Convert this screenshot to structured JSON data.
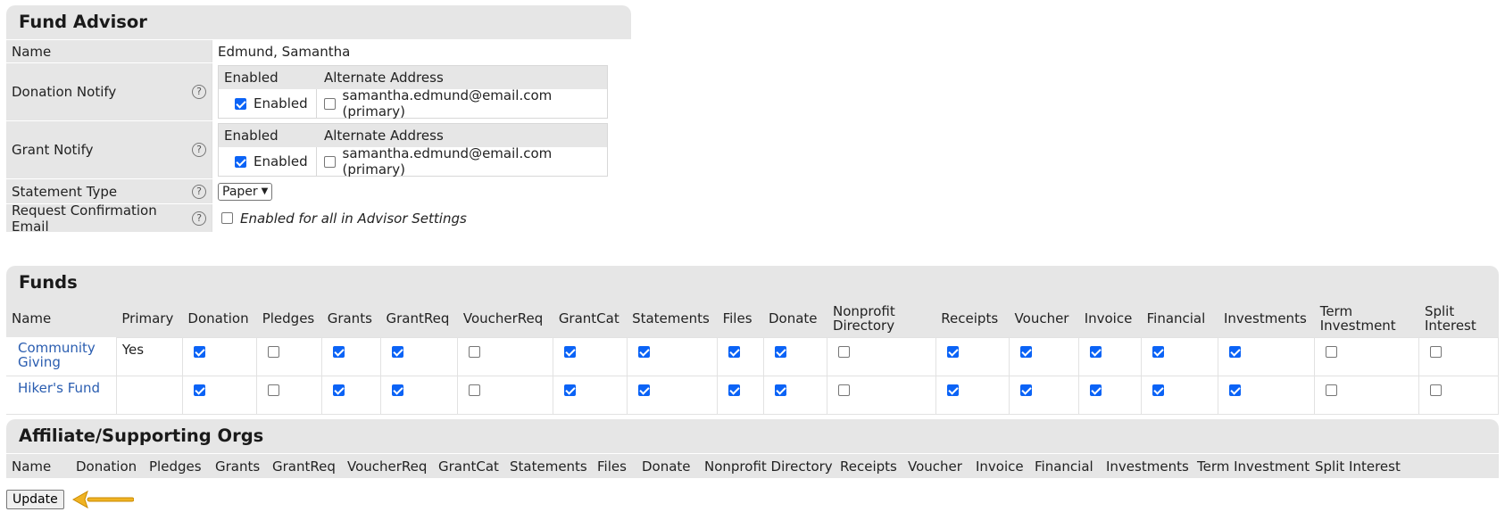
{
  "advisor": {
    "title": "Fund Advisor",
    "name_label": "Name",
    "name_value": "Edmund, Samantha",
    "donation_notify": {
      "label": "Donation Notify",
      "col_enabled": "Enabled",
      "col_alt": "Alternate Address",
      "enabled_label": "Enabled",
      "enabled_checked": true,
      "alt_checked": false,
      "alt_address": "samantha.edmund@email.com (primary)"
    },
    "grant_notify": {
      "label": "Grant Notify",
      "col_enabled": "Enabled",
      "col_alt": "Alternate Address",
      "enabled_label": "Enabled",
      "enabled_checked": true,
      "alt_checked": false,
      "alt_address": "samantha.edmund@email.com (primary)"
    },
    "statement_type": {
      "label": "Statement Type",
      "selected": "Paper"
    },
    "request_confirmation": {
      "label": "Request Confirmation Email",
      "checked": false,
      "note": "Enabled for all in Advisor Settings"
    },
    "help_glyph": "?"
  },
  "funds": {
    "title": "Funds",
    "columns": [
      "Name",
      "Primary",
      "Donation",
      "Pledges",
      "Grants",
      "GrantReq",
      "VoucherReq",
      "GrantCat",
      "Statements",
      "Files",
      "Donate",
      "Nonprofit Directory",
      "Receipts",
      "Voucher",
      "Invoice",
      "Financial",
      "Investments",
      "Term Investment",
      "Split Interest"
    ],
    "rows": [
      {
        "name": "Community Giving",
        "primary": "Yes",
        "flags": [
          true,
          false,
          true,
          true,
          false,
          true,
          true,
          true,
          true,
          false,
          true,
          true,
          true,
          true,
          true,
          false,
          false
        ]
      },
      {
        "name": "Hiker's Fund",
        "primary": "",
        "flags": [
          true,
          false,
          true,
          true,
          false,
          true,
          true,
          true,
          true,
          false,
          true,
          true,
          true,
          true,
          true,
          false,
          false
        ]
      }
    ]
  },
  "affiliates": {
    "title": "Affiliate/Supporting Orgs",
    "columns": [
      "Name",
      "Donation",
      "Pledges",
      "Grants",
      "GrantReq",
      "VoucherReq",
      "GrantCat",
      "Statements",
      "Files",
      "Donate",
      "Nonprofit Directory",
      "Receipts",
      "Voucher",
      "Invoice",
      "Financial",
      "Investments",
      "Term Investment",
      "Split Interest"
    ]
  },
  "update_label": "Update",
  "colors": {
    "accent": "#0b63f6",
    "link": "#2a5db0",
    "arrow": "#f0b323",
    "panel": "#e6e6e6"
  }
}
